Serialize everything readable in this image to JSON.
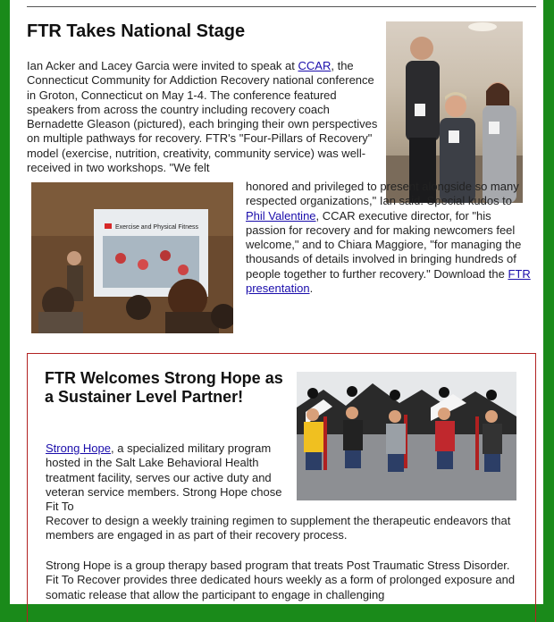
{
  "article1": {
    "title": "FTR Takes National Stage",
    "para_a": "Ian Acker and Lacey Garcia were invited to speak at ",
    "link_ccar": "CCAR",
    "para_b": ", the Connecticut Community for Addiction Recovery national conference in Groton, Connecticut on May 1-4. The conference featured speakers from across the country including recovery coach Bernadette Gleason (pictured), each bringing their own perspectives on multiple pathways for recovery. FTR's \"Four-Pillars of Recovery\" model (exercise, nutrition, creativity, community service) was well-received in two workshops. \"We felt",
    "para_c": "honored and privileged to present alongside so many respected organizations,\" Ian said. Special kudos to ",
    "link_phil": "Phil Valentine",
    "para_d": ", CCAR executive director, for \"his passion for recovery and for making newcomers feel welcome,\" and to Chiara Maggiore, \"for managing the thousands of details involved in bringing hundreds of people together to further recovery.\" Download the ",
    "link_presentation": "FTR presentation",
    "para_e": ".",
    "slide_title": "Exercise and Physical Fitness"
  },
  "article2": {
    "title": "FTR Welcomes Strong Hope as a Sustainer Level Partner!",
    "link_strong_hope": "Strong Hope",
    "para_a": ", a specialized military program hosted in the Salt Lake Behavioral Health treatment facility, serves our active duty and veteran service members. Strong Hope chose Fit To",
    "para_b": "Recover to design a weekly training regimen to supplement the therapeutic endeavors that members are engaged in as part of their recovery process.",
    "para_c": "Strong Hope is a group therapy based program that treats Post Traumatic Stress Disorder. Fit To Recover provides three dedicated hours weekly as a form of prolonged exposure and somatic release that allow the participant to engage in challenging"
  }
}
